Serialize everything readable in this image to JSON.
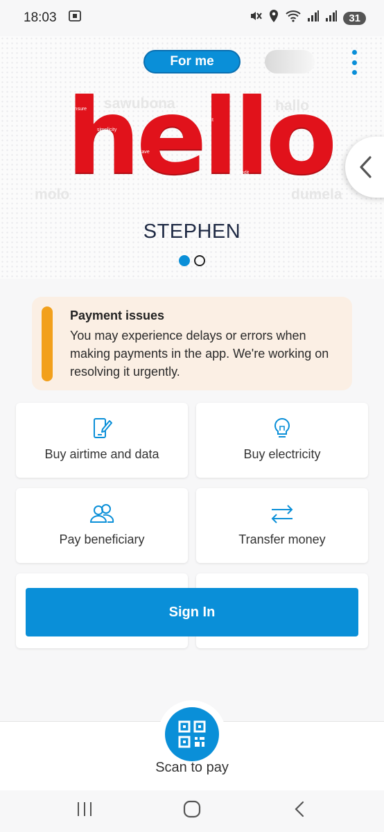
{
  "status_bar": {
    "time": "18:03",
    "battery": "31",
    "icons": [
      "screenshot-icon",
      "mute-icon",
      "location-icon",
      "wifi-icon",
      "signal-icon",
      "signal-icon",
      "battery-icon"
    ]
  },
  "header": {
    "profile_toggle_label": "For me",
    "menu_icon": "kebab-menu-icon"
  },
  "hero": {
    "greeting_main": "hello",
    "greetings": [
      "sawubona",
      "hallo",
      "molo",
      "dumela"
    ],
    "hello_inner_words": [
      "insure",
      "simplicity",
      "transact",
      "save",
      "credit"
    ],
    "user_name": "STEPHEN",
    "carousel_active_index": 0,
    "carousel_count": 2
  },
  "alert": {
    "title": "Payment issues",
    "message": "You may experience delays or errors when making payments in the app. We're working on resolving it urgently."
  },
  "quick_actions": [
    {
      "label": "Buy airtime and data",
      "icon": "phone-edit-icon"
    },
    {
      "label": "Buy electricity",
      "icon": "lightbulb-icon"
    },
    {
      "label": "Pay beneficiary",
      "icon": "people-icon"
    },
    {
      "label": "Transfer money",
      "icon": "transfer-arrows-icon"
    }
  ],
  "sign_in": {
    "label": "Sign In"
  },
  "scan": {
    "label": "Scan to pay",
    "icon": "qr-code-icon"
  },
  "colors": {
    "primary": "#0a8fd8",
    "brand_red": "#e1121b",
    "alert_accent": "#f2a01c",
    "alert_bg": "#fbefe4"
  }
}
